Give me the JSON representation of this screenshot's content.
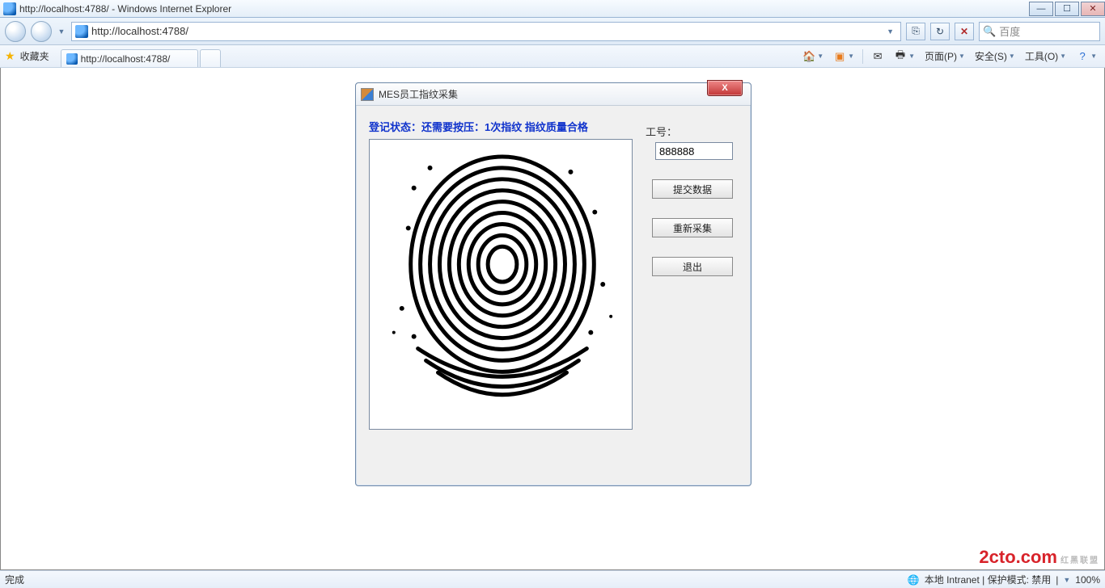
{
  "window": {
    "title": "http://localhost:4788/ - Windows Internet Explorer"
  },
  "nav": {
    "address": "http://localhost:4788/",
    "search_placeholder": "百度"
  },
  "favbar": {
    "favorites_label": "收藏夹",
    "tab_title": "http://localhost:4788/"
  },
  "command_bar": {
    "page": "页面(P)",
    "safety": "安全(S)",
    "tools": "工具(O)"
  },
  "dialog": {
    "title": "MES员工指纹采集",
    "status": "登记状态：还需要按压：1次指纹 指纹质量合格",
    "emp_label": "工号：",
    "emp_value": "888888",
    "btn_submit": "提交数据",
    "btn_recapture": "重新采集",
    "btn_exit": "退出"
  },
  "statusbar": {
    "left": "完成",
    "zone": "本地 Intranet | 保护模式: 禁用",
    "zoom": "100%"
  },
  "watermark": {
    "text": "2cto",
    "suffix": ".com",
    "sub": "红黑联盟"
  }
}
